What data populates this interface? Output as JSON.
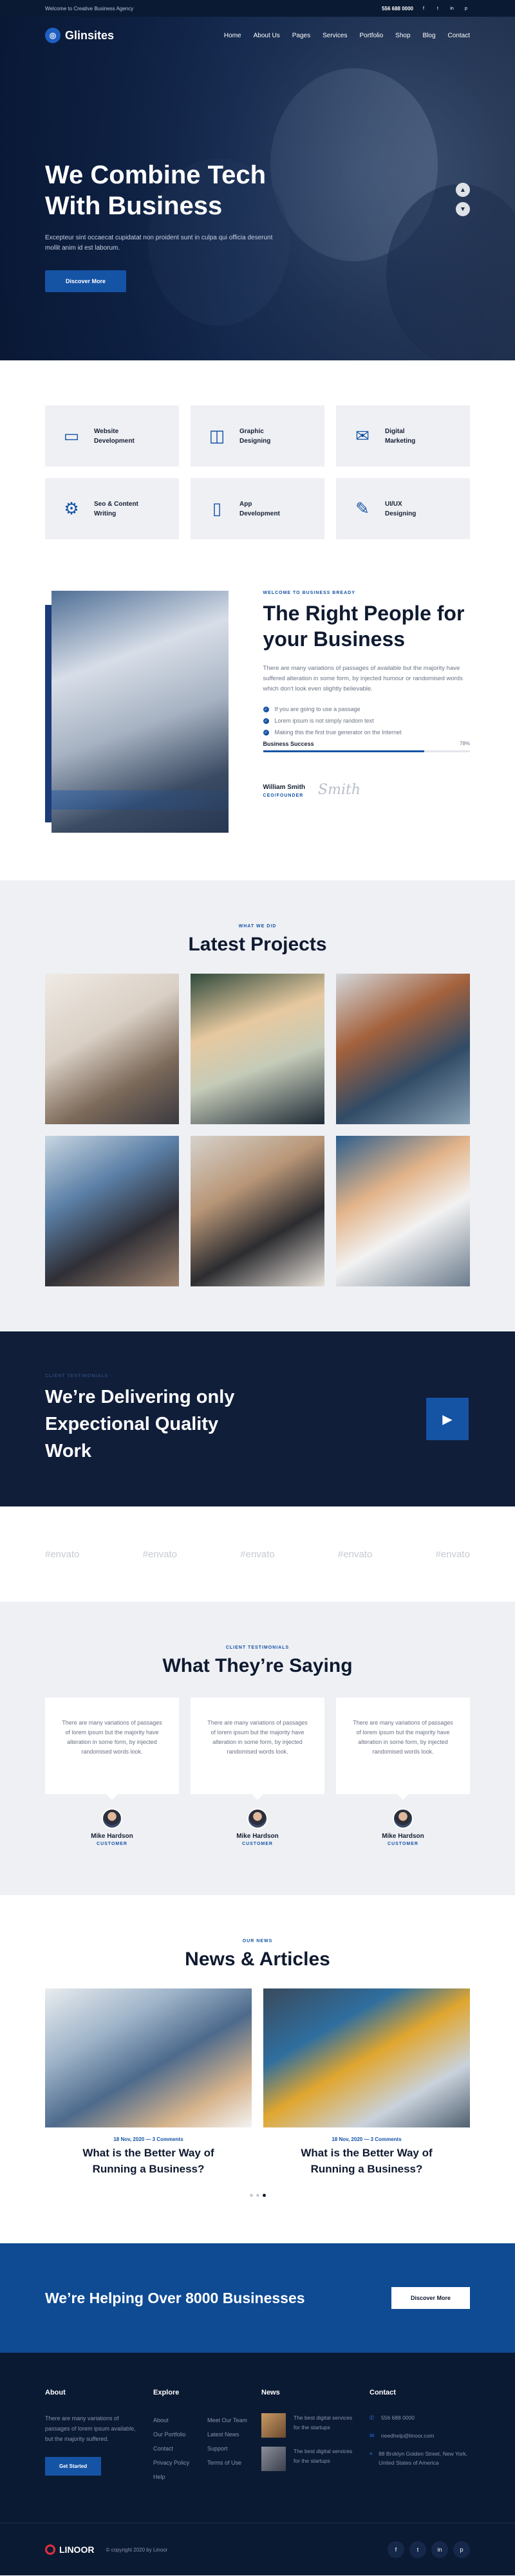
{
  "topbar": {
    "welcome": "Welcome to Creative Business Agency",
    "phone": "556 688 0000",
    "social": [
      "f",
      "t",
      "in",
      "p"
    ]
  },
  "nav": {
    "logo": "Glinsites",
    "menu": [
      "Home",
      "About Us",
      "Pages",
      "Services",
      "Portfolio",
      "Shop",
      "Blog",
      "Contact"
    ]
  },
  "hero": {
    "title_line1": "We Combine Tech",
    "title_line2": "With Business",
    "text": "Excepteur sint occaecat cupidatat non proident sunt in culpa qui officia deserunt mollit anim id est laborum.",
    "button": "Discover More"
  },
  "services": [
    {
      "line1": "Website",
      "line2": "Development",
      "icon": "monitor-icon"
    },
    {
      "line1": "Graphic",
      "line2": "Designing",
      "icon": "design-icon"
    },
    {
      "line1": "Digital",
      "line2": "Marketing",
      "icon": "marketing-icon"
    },
    {
      "line1": "Seo & Content",
      "line2": "Writing",
      "icon": "seo-icon"
    },
    {
      "line1": "App",
      "line2": "Development",
      "icon": "app-icon"
    },
    {
      "line1": "UI/UX",
      "line2": "Designing",
      "icon": "uiux-icon"
    }
  ],
  "about": {
    "eyebrow": "WELCOME TO BUSINESS BREADY",
    "title_line1": "The Right People for",
    "title_line2": "your Business",
    "desc": "There are many variations of passages of available but the majority have suffered alteration in some form, by injected humour or randomised words which don't look even slightly believable.",
    "checks": [
      "If you are going to use a passage",
      "Lorem ipsum is not simply random text",
      "Making this the first true generator on the Internet"
    ],
    "progress_label": "Business Success",
    "progress_pct": "78%",
    "progress_value": 0.78,
    "sig_name": "William Smith",
    "sig_role": "CEO/FOUNDER",
    "signature": "Smith"
  },
  "projects": {
    "eyebrow": "WHAT WE DID",
    "title": "Latest Projects"
  },
  "quality": {
    "eyebrow": "CLIENT TESTIMONIALS",
    "line1": "We’re Delivering only",
    "line2": "Expectional Quality",
    "line3": "Work"
  },
  "brands": [
    "#envato",
    "#envato",
    "#envato",
    "#envato",
    "#envato"
  ],
  "testimonials": {
    "eyebrow": "CLIENT TESTIMONIALS",
    "title": "What They’re Saying",
    "items": [
      {
        "text": "There are many variations of passages of lorem ipsum but the majority have alteration in some form, by injected randomised words look.",
        "name": "Mike Hardson",
        "role": "CUSTOMER"
      },
      {
        "text": "There are many variations of passages of lorem ipsum but the majority have alteration in some form, by injected randomised words look.",
        "name": "Mike Hardson",
        "role": "CUSTOMER"
      },
      {
        "text": "There are many variations of passages of lorem ipsum but the majority have alteration in some form, by injected randomised words look.",
        "name": "Mike Hardson",
        "role": "CUSTOMER"
      }
    ]
  },
  "news": {
    "eyebrow": "OUR NEWS",
    "title": "News & Articles",
    "items": [
      {
        "date": "18 Nov, 2020 — 3 Comments",
        "title_line1": "What is the Better Way of",
        "title_line2": "Running a Business?"
      },
      {
        "date": "18 Nov, 2020 — 3 Comments",
        "title_line1": "What is the Better Way of",
        "title_line2": "Running a Business?"
      }
    ]
  },
  "cta": {
    "title": "We’re Helping Over 8000 Businesses",
    "button": "Discover More"
  },
  "footer": {
    "about_title": "About",
    "about_text": "There are many variations of passages of lorem ipsum available, but the majority suffered.",
    "about_button": "Get Started",
    "explore_title": "Explore",
    "explore_col1": [
      "About",
      "Our Portfolio",
      "Contact",
      "Privacy Policy",
      "Help"
    ],
    "explore_col2": [
      "Meet Our Team",
      "Latest News",
      "Support",
      "Terms of Use"
    ],
    "news_title": "News",
    "news_items": [
      "The best digital services for the startups",
      "The best digital services for the startups"
    ],
    "contact_title": "Contact",
    "contact_phone": "556 688 0000",
    "contact_email": "needhelp@linoor.com",
    "contact_address": "88 Broklyn Golden Street, New York, United States of America",
    "logo": "LINOOR",
    "copyright": "© copyright 2020 by Linoor",
    "social": [
      "f",
      "t",
      "in",
      "p"
    ]
  },
  "colors": {
    "primary": "#1553a5",
    "navy": "#0b1a33",
    "light": "#eef0f4"
  }
}
